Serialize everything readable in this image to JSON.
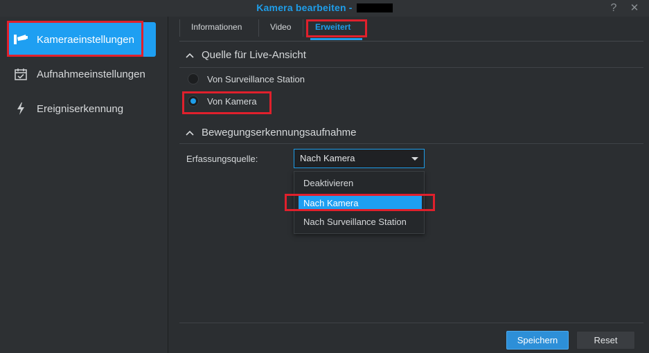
{
  "window": {
    "title": "Kamera bearbeiten - ",
    "help_label": "?",
    "close_label": "✕"
  },
  "sidebar": {
    "items": [
      {
        "label": "Kameraeinstellungen",
        "icon": "camera-icon",
        "active": true
      },
      {
        "label": "Aufnahmeeinstellungen",
        "icon": "calendar-icon",
        "active": false
      },
      {
        "label": "Ereigniserkennung",
        "icon": "lightning-icon",
        "active": false
      }
    ]
  },
  "tabs": [
    {
      "label": "Informationen",
      "active": false
    },
    {
      "label": "Video",
      "active": false
    },
    {
      "label": "Erweitert",
      "active": true
    }
  ],
  "live_view": {
    "heading": "Quelle für Live-Ansicht",
    "options": [
      {
        "label": "Von Surveillance Station",
        "checked": false
      },
      {
        "label": "Von Kamera",
        "checked": true
      }
    ]
  },
  "motion": {
    "heading": "Bewegungserkennungsaufnahme",
    "field_label": "Erfassungsquelle:",
    "selected_value": "Nach Kamera",
    "options": [
      {
        "label": "Deaktivieren",
        "selected": false
      },
      {
        "label": "Nach Kamera",
        "selected": true
      },
      {
        "label": "Nach Surveillance Station",
        "selected": false
      }
    ]
  },
  "footer": {
    "save_label": "Speichern",
    "reset_label": "Reset"
  },
  "colors": {
    "accent": "#1e9eea",
    "highlight_frame": "#e0202c",
    "background": "#2b2e31"
  }
}
